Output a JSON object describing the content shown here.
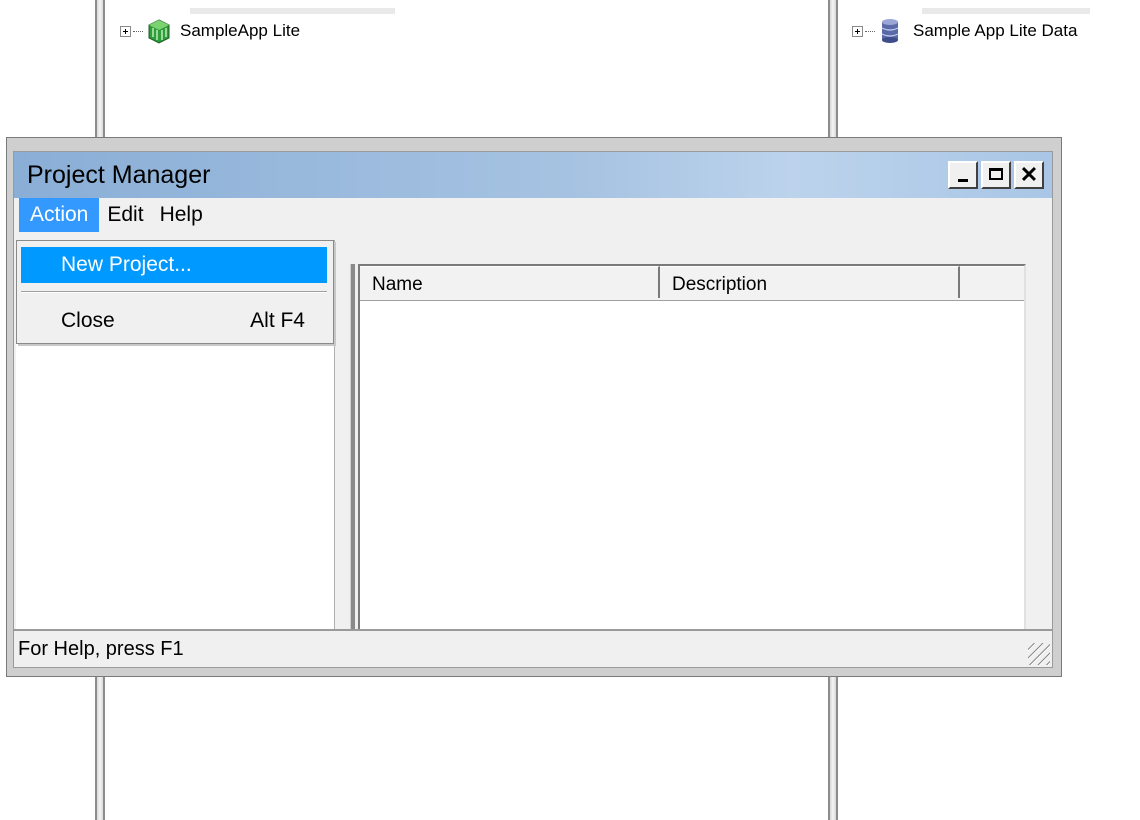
{
  "background_tree": {
    "left_node_label": "SampleApp Lite",
    "right_node_label": "Sample App Lite Data"
  },
  "window": {
    "title": "Project Manager",
    "controls": {
      "minimize": "_",
      "maximize": "□",
      "close": "✕"
    }
  },
  "menubar": {
    "items": [
      "Action",
      "Edit",
      "Help"
    ],
    "active": "Action"
  },
  "action_menu": {
    "items": [
      {
        "label": "New Project...",
        "accelerator": ""
      },
      {
        "label": "Close",
        "accelerator": "Alt F4"
      }
    ],
    "highlighted": "New Project..."
  },
  "list": {
    "columns": [
      "Name",
      "Description"
    ]
  },
  "statusbar": {
    "text": "For Help, press F1"
  },
  "colors": {
    "title_gradient_start": "#8aaed6",
    "title_gradient_end": "#bcd3ec",
    "menu_highlight": "#3399ff",
    "dropdown_highlight": "#0099ff",
    "app_icon": "#2e9d3a",
    "db_icon": "#5a6aa8"
  },
  "icons": {
    "left_node": "green-cube-app-icon",
    "right_node": "database-cylinder-icon",
    "expander": "tree-plus-expander-icon",
    "size_grip": "resize-grip-icon"
  }
}
